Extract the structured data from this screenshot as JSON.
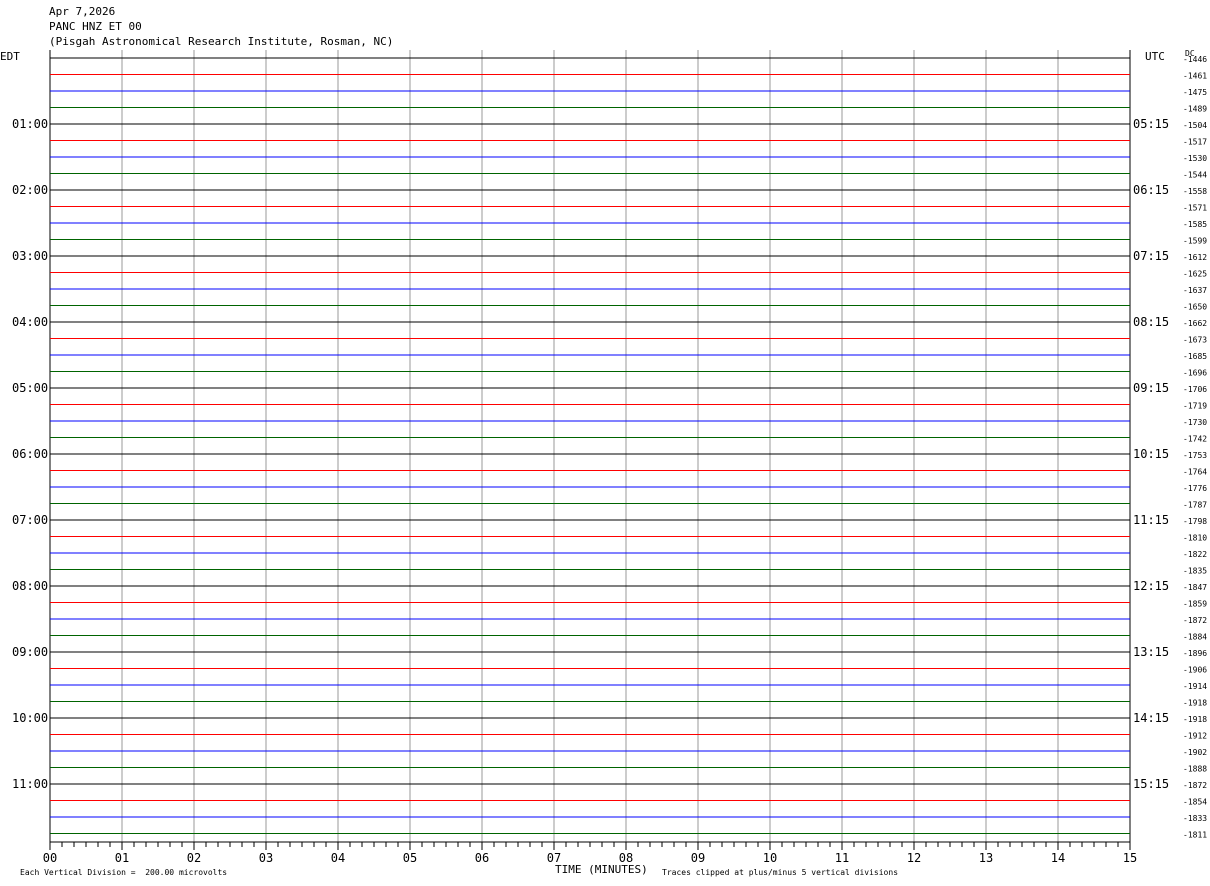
{
  "header": {
    "date": "Apr 7,2026",
    "station": "PANC HNZ ET 00",
    "institution": "(Pisgah Astronomical Research Institute, Rosman, NC)"
  },
  "left_timezone": "EDT",
  "right_timezone": "UTC",
  "dc_label": "DC",
  "footer": {
    "scale_note": "Each Vertical Division =  200.00 microvolts",
    "xlabel": "TIME (MINUTES)",
    "clip_note": "Traces clipped at plus/minus 5 vertical divisions"
  },
  "chart_data": {
    "type": "line",
    "title": "PANC HNZ ET 00",
    "xlabel": "TIME (MINUTES)",
    "ylabel": "",
    "xlim": [
      0,
      15
    ],
    "x_ticks": [
      "00",
      "01",
      "02",
      "03",
      "04",
      "05",
      "06",
      "07",
      "08",
      "09",
      "10",
      "11",
      "12",
      "13",
      "14",
      "15"
    ],
    "trace_colors": [
      "#000000",
      "#ff0000",
      "#0000ff",
      "#006400"
    ],
    "left_time_labels": [
      "01:00",
      "02:00",
      "03:00",
      "04:00",
      "05:00",
      "06:00",
      "07:00",
      "08:00",
      "09:00",
      "10:00",
      "11:00"
    ],
    "right_time_labels": [
      "05:15",
      "06:15",
      "07:15",
      "08:15",
      "09:15",
      "10:15",
      "11:15",
      "12:15",
      "13:15",
      "14:15",
      "15:15"
    ],
    "dc_offsets": [
      -1446,
      -1461,
      -1475,
      -1489,
      -1504,
      -1517,
      -1530,
      -1544,
      -1558,
      -1571,
      -1585,
      -1599,
      -1612,
      -1625,
      -1637,
      -1650,
      -1662,
      -1673,
      -1685,
      -1696,
      -1706,
      -1719,
      -1730,
      -1742,
      -1753,
      -1764,
      -1776,
      -1787,
      -1798,
      -1810,
      -1822,
      -1835,
      -1847,
      -1859,
      -1872,
      -1884,
      -1896,
      -1906,
      -1914,
      -1918,
      -1918,
      -1912,
      -1902,
      -1888,
      -1872,
      -1854,
      -1833,
      -1811
    ]
  }
}
